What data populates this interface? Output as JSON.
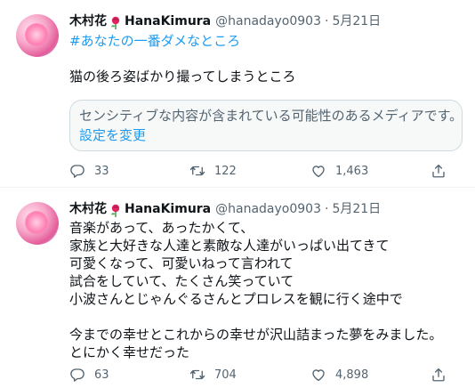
{
  "tweets": [
    {
      "name": "木村花",
      "display_suffix": "HanaKimura",
      "handle": "@hanadayo0903",
      "dot": "·",
      "date": "5月21日",
      "hashtag": "#あなたの一番ダメなところ",
      "text": "猫の後ろ姿ばかり撮ってしまうところ",
      "sensitive_notice": "センシティブな内容が含まれている可能性のあるメディアです。",
      "sensitive_link": "設定を変更",
      "replies": "33",
      "retweets": "122",
      "likes": "1,463"
    },
    {
      "name": "木村花",
      "display_suffix": "HanaKimura",
      "handle": "@hanadayo0903",
      "dot": "·",
      "date": "5月21日",
      "text": "音楽があって、あったかくて、\n家族と大好きな人達と素敵な人達がいっぱい出てきて\n可愛くなって、可愛いねって言われて\n試合をしていて、たくさん笑っていて\n小波さんとじゃんぐるさんとプロレスを観に行く途中で\n\n今までの幸せとこれからの幸せが沢山詰まった夢をみました。\nとにかく幸せだった",
      "replies": "63",
      "retweets": "704",
      "likes": "4,898"
    }
  ],
  "icons": {
    "reply": "reply-icon",
    "retweet": "retweet-icon",
    "like": "heart-icon",
    "share": "share-icon",
    "flower": "rose-emoji-icon"
  },
  "colors": {
    "link": "#1d9bf0",
    "secondary": "#536471",
    "text": "#0f1419"
  }
}
